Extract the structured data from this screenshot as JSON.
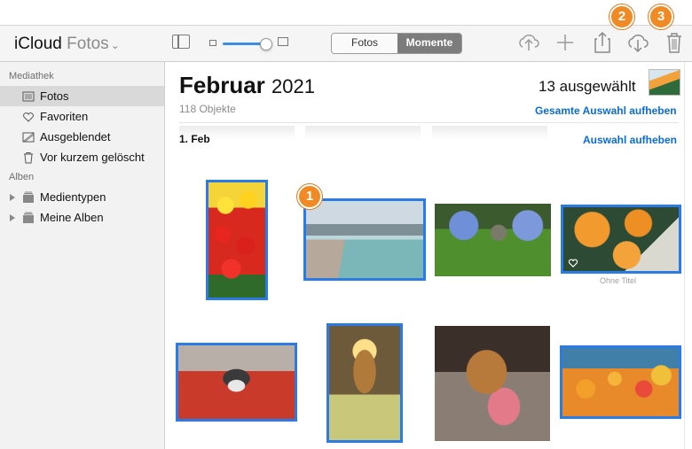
{
  "app": {
    "brand": "iCloud",
    "brand_sub": "Fotos",
    "chevron": "⌄"
  },
  "toolbar": {
    "view_fotos": "Fotos",
    "view_momente": "Momente",
    "zoom_level": 0.85
  },
  "badges": {
    "b1": "1",
    "b2": "2",
    "b3": "3"
  },
  "sidebar": {
    "section_library": "Mediathek",
    "items": [
      {
        "label": "Fotos",
        "icon": "photos-icon"
      },
      {
        "label": "Favoriten",
        "icon": "heart-icon"
      },
      {
        "label": "Ausgeblendet",
        "icon": "hidden-icon"
      },
      {
        "label": "Vor kurzem gelöscht",
        "icon": "trash-icon"
      }
    ],
    "section_albums": "Alben",
    "albums": [
      {
        "label": "Medientypen",
        "icon": "album-stack-icon"
      },
      {
        "label": "Meine Alben",
        "icon": "album-stack-icon"
      }
    ]
  },
  "main": {
    "month": "Februar",
    "year": "2021",
    "object_count": "118 Objekte",
    "selected_count": "13 ausgewählt",
    "deselect_all": "Gesamte Auswahl aufheben",
    "date_label": "1. Feb",
    "deselect_group": "Auswahl aufheben",
    "photo_caption": "Ohne Titel"
  }
}
